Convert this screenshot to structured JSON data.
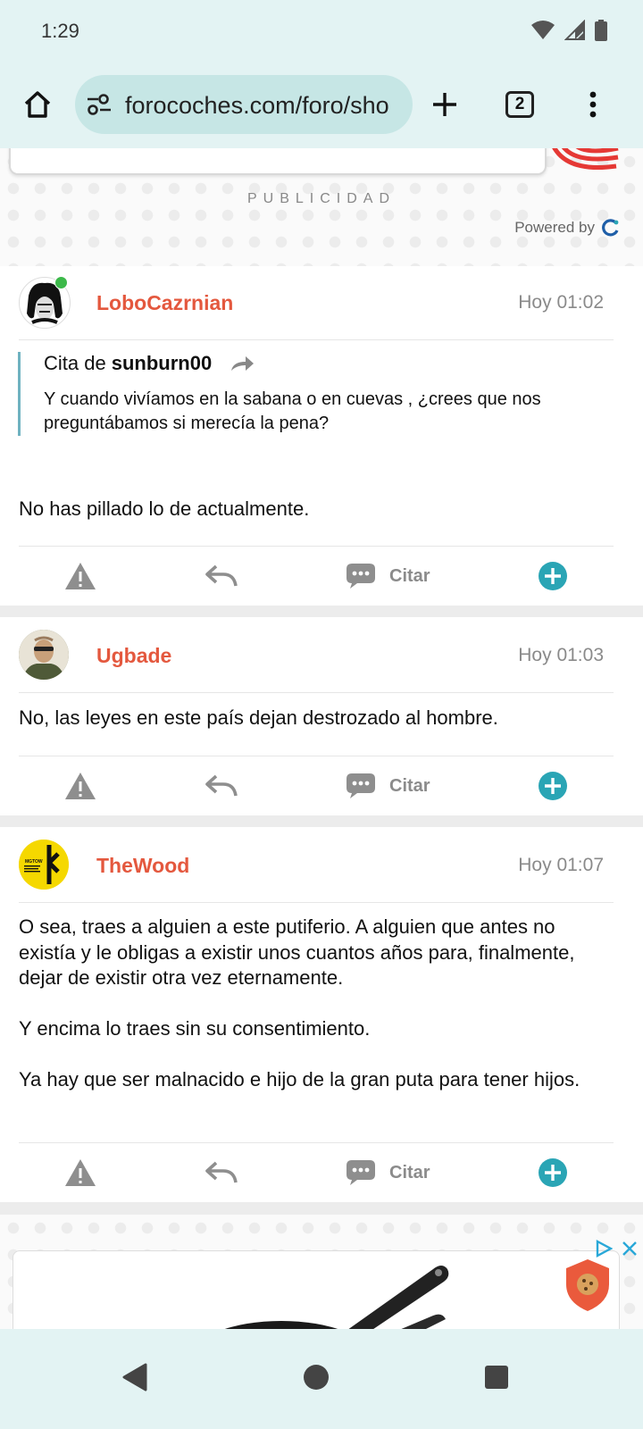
{
  "status_bar": {
    "time": "1:29"
  },
  "browser": {
    "url": "forocoches.com/foro/sho",
    "tab_count": "2"
  },
  "ad_top": {
    "label": "PUBLICIDAD",
    "powered_by": "Powered by"
  },
  "posts": [
    {
      "username": "LoboCazrnian",
      "time": "Hoy 01:02",
      "online": true,
      "quote": {
        "prefix": "Cita de",
        "author": "sunburn00",
        "text": "Y cuando vivíamos en la sabana o en cuevas , ¿crees que nos preguntábamos si merecía la pena?"
      },
      "body": "No has pillado lo de actualmente."
    },
    {
      "username": "Ugbade",
      "time": "Hoy 01:03",
      "body": "No, las leyes en este país dejan destrozado al hombre."
    },
    {
      "username": "TheWood",
      "time": "Hoy 01:07",
      "avatar_text": "MGTOW",
      "body_paragraphs": [
        "O sea, traes a alguien a este putiferio. A alguien que antes no existía y le obligas a existir unos cuantos años para, finalmente, dejar de existir otra vez eternamente.",
        "Y encima lo traes sin su consentimiento.",
        "Ya hay que ser malnacido e hijo de la gran puta para tener hijos."
      ]
    }
  ],
  "actions": {
    "quote_label": "Citar"
  },
  "colors": {
    "username": "#e4583e",
    "accent": "#2aa5b5",
    "quote_border": "#6fb2c0",
    "chrome": "#e3f3f3"
  }
}
